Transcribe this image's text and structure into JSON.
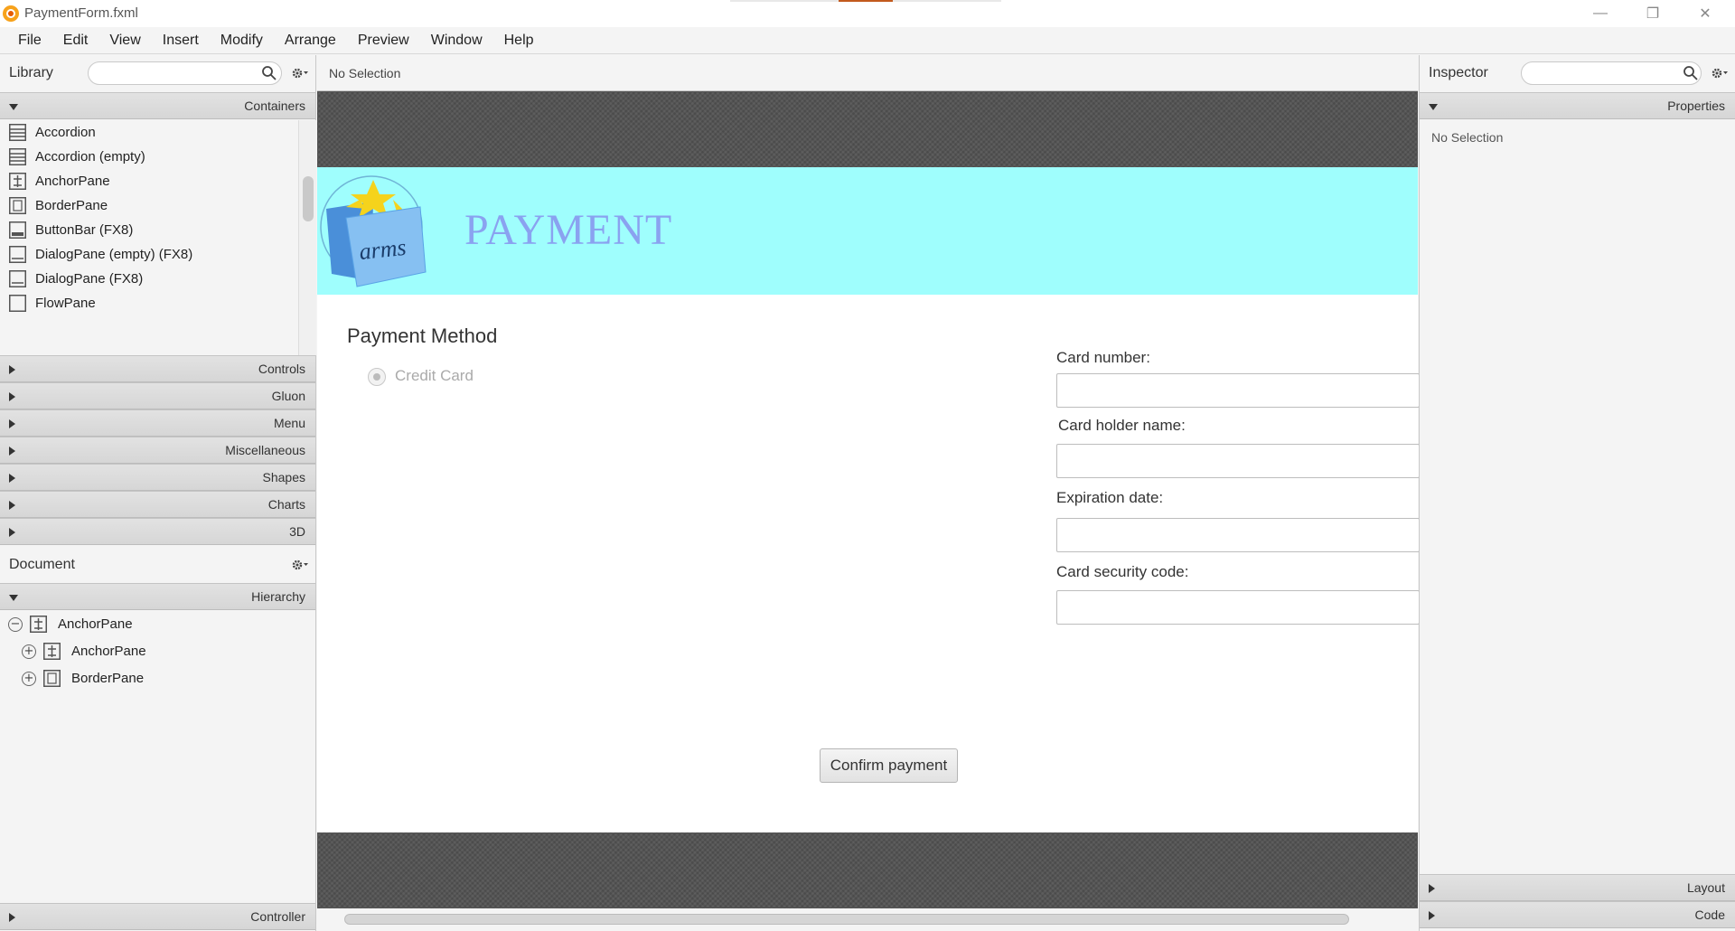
{
  "window": {
    "title": "PaymentForm.fxml",
    "minimize": "—",
    "maximize": "❐",
    "close": "✕"
  },
  "menu": [
    "File",
    "Edit",
    "View",
    "Insert",
    "Modify",
    "Arrange",
    "Preview",
    "Window",
    "Help"
  ],
  "library": {
    "title": "Library",
    "sections": {
      "containers": "Containers",
      "controls": "Controls",
      "gluon": "Gluon",
      "menu": "Menu",
      "miscellaneous": "Miscellaneous",
      "shapes": "Shapes",
      "charts": "Charts",
      "three_d": "3D"
    },
    "items": [
      "Accordion",
      "Accordion  (empty)",
      "AnchorPane",
      "BorderPane",
      "ButtonBar  (FX8)",
      "DialogPane (empty)  (FX8)",
      "DialogPane  (FX8)",
      "FlowPane"
    ]
  },
  "document": {
    "title": "Document",
    "hierarchy_label": "Hierarchy",
    "tree": [
      {
        "label": "AnchorPane",
        "toggle": "−"
      },
      {
        "label": "AnchorPane",
        "toggle": "+"
      },
      {
        "label": "BorderPane",
        "toggle": "+"
      }
    ],
    "controller_label": "Controller"
  },
  "center": {
    "status": "No Selection"
  },
  "form": {
    "logo_text": "arms",
    "banner_title": "PAYMENT",
    "payment_method_heading": "Payment Method",
    "credit_card_label": "Credit Card",
    "fields": [
      {
        "label": "Card number:",
        "value": ""
      },
      {
        "label": "Card holder name:",
        "value": ""
      },
      {
        "label": "Expiration date:",
        "value": ""
      },
      {
        "label": "Card security code:",
        "value": ""
      }
    ],
    "confirm_button": "Confirm payment"
  },
  "inspector": {
    "title": "Inspector",
    "properties_label": "Properties",
    "no_selection": "No Selection",
    "layout_label": "Layout",
    "code_label": "Code"
  },
  "colors": {
    "banner_bg": "#9ffefd",
    "banner_title": "#8aa2f0",
    "canvas_bg": "#555555",
    "panel_bg": "#f4f4f4"
  }
}
